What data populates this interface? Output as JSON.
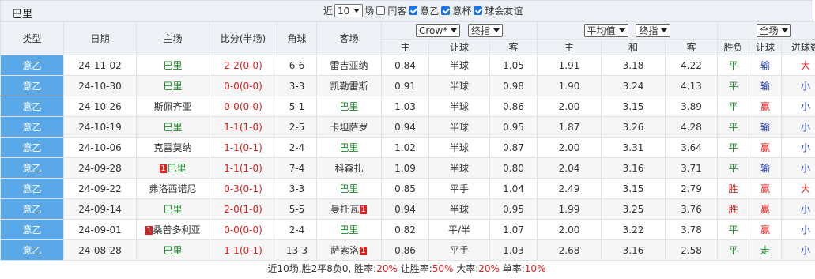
{
  "header": {
    "team_title": "巴里",
    "near_label": "近",
    "count_select": "10",
    "games_label": "场",
    "same_host_label": "同客",
    "filter_league1": "意乙",
    "filter_league2": "意杯",
    "filter_friendly": "球会友谊",
    "same_host_checked": false,
    "league1_checked": true,
    "league2_checked": true,
    "friendly_checked": true
  },
  "columns": {
    "type": "类型",
    "date": "日期",
    "home": "主场",
    "score": "比分(半场)",
    "corner": "角球",
    "away": "客场",
    "company_select": "Crow*",
    "odds_type_select": "终指",
    "avg_select": "平均值",
    "avg_type_select": "终指",
    "scope_select": "全场",
    "h_home": "主",
    "h_handicap": "让球",
    "h_away": "客",
    "h2_home": "主",
    "h2_draw": "和",
    "h2_away": "客",
    "h_result": "胜负",
    "h_handicap_result": "让球",
    "h_goals": "进球数"
  },
  "rows": [
    {
      "league": "意乙",
      "date": "24-11-02",
      "home": "巴里",
      "home_red": "",
      "home_is_team": true,
      "score": "2-2",
      "half": "(0-0)",
      "score_color": "red",
      "corner": "6-6",
      "away": "雷吉亚纳",
      "away_red": "",
      "away_is_team": false,
      "o_home": "0.84",
      "handicap": "半球",
      "o_away": "1.05",
      "a_home": "1.91",
      "a_draw": "3.18",
      "a_away": "4.22",
      "result": "平",
      "res_color": "green",
      "hres": "输",
      "hres_color": "blue",
      "goals": "大",
      "goals_color": "red"
    },
    {
      "league": "意乙",
      "date": "24-10-30",
      "home": "巴里",
      "home_red": "",
      "home_is_team": true,
      "score": "0-0",
      "half": "(0-0)",
      "score_color": "red",
      "corner": "3-3",
      "away": "凯勒雷斯",
      "away_red": "",
      "away_is_team": false,
      "o_home": "0.91",
      "handicap": "半球",
      "o_away": "0.98",
      "a_home": "1.90",
      "a_draw": "3.24",
      "a_away": "4.13",
      "result": "平",
      "res_color": "green",
      "hres": "输",
      "hres_color": "blue",
      "goals": "小",
      "goals_color": "blue"
    },
    {
      "league": "意乙",
      "date": "24-10-26",
      "home": "斯佩齐亚",
      "home_red": "",
      "home_is_team": false,
      "score": "0-0",
      "half": "(0-0)",
      "score_color": "red",
      "corner": "5-1",
      "away": "巴里",
      "away_red": "",
      "away_is_team": true,
      "o_home": "1.03",
      "handicap": "半球",
      "o_away": "0.86",
      "a_home": "2.00",
      "a_draw": "3.15",
      "a_away": "3.89",
      "result": "平",
      "res_color": "green",
      "hres": "赢",
      "hres_color": "red",
      "goals": "小",
      "goals_color": "blue"
    },
    {
      "league": "意乙",
      "date": "24-10-19",
      "home": "巴里",
      "home_red": "",
      "home_is_team": true,
      "score": "1-1",
      "half": "(1-0)",
      "score_color": "red",
      "corner": "2-5",
      "away": "卡坦萨罗",
      "away_red": "",
      "away_is_team": false,
      "o_home": "0.94",
      "handicap": "半球",
      "o_away": "0.95",
      "a_home": "1.87",
      "a_draw": "3.26",
      "a_away": "4.28",
      "result": "平",
      "res_color": "green",
      "hres": "输",
      "hres_color": "blue",
      "goals": "小",
      "goals_color": "blue"
    },
    {
      "league": "意乙",
      "date": "24-10-06",
      "home": "克雷莫纳",
      "home_red": "",
      "home_is_team": false,
      "score": "1-1",
      "half": "(0-1)",
      "score_color": "red",
      "corner": "2-4",
      "away": "巴里",
      "away_red": "",
      "away_is_team": true,
      "o_home": "1.02",
      "handicap": "半球",
      "o_away": "0.87",
      "a_home": "2.00",
      "a_draw": "3.31",
      "a_away": "3.64",
      "result": "平",
      "res_color": "green",
      "hres": "赢",
      "hres_color": "red",
      "goals": "小",
      "goals_color": "blue"
    },
    {
      "league": "意乙",
      "date": "24-09-28",
      "home": "巴里",
      "home_red": "1",
      "home_is_team": true,
      "score": "1-1",
      "half": "(1-0)",
      "score_color": "red",
      "corner": "7-4",
      "away": "科森扎",
      "away_red": "",
      "away_is_team": false,
      "o_home": "1.09",
      "handicap": "半球",
      "o_away": "0.80",
      "a_home": "2.04",
      "a_draw": "3.16",
      "a_away": "3.71",
      "result": "平",
      "res_color": "green",
      "hres": "输",
      "hres_color": "blue",
      "goals": "小",
      "goals_color": "blue"
    },
    {
      "league": "意乙",
      "date": "24-09-22",
      "home": "弗洛西诺尼",
      "home_red": "",
      "home_is_team": false,
      "score": "0-3",
      "half": "(0-1)",
      "score_color": "red",
      "corner": "3-3",
      "away": "巴里",
      "away_red": "",
      "away_is_team": true,
      "o_home": "0.85",
      "handicap": "平手",
      "o_away": "1.04",
      "a_home": "2.49",
      "a_draw": "3.15",
      "a_away": "2.79",
      "result": "胜",
      "res_color": "red",
      "hres": "赢",
      "hres_color": "red",
      "goals": "大",
      "goals_color": "red"
    },
    {
      "league": "意乙",
      "date": "24-09-14",
      "home": "巴里",
      "home_red": "",
      "home_is_team": true,
      "score": "2-0",
      "half": "(1-0)",
      "score_color": "red",
      "corner": "5-5",
      "away": "曼托瓦",
      "away_red": "1",
      "away_is_team": false,
      "o_home": "0.94",
      "handicap": "半球",
      "o_away": "0.95",
      "a_home": "1.99",
      "a_draw": "3.25",
      "a_away": "3.76",
      "result": "胜",
      "res_color": "red",
      "hres": "赢",
      "hres_color": "red",
      "goals": "小",
      "goals_color": "blue"
    },
    {
      "league": "意乙",
      "date": "24-09-01",
      "home": "桑普多利亚",
      "home_red": "1",
      "home_is_team": false,
      "score": "0-0",
      "half": "(0-0)",
      "score_color": "red",
      "corner": "2-4",
      "away": "巴里",
      "away_red": "",
      "away_is_team": true,
      "o_home": "0.82",
      "handicap": "平/半",
      "o_away": "1.07",
      "a_home": "2.00",
      "a_draw": "3.22",
      "a_away": "3.78",
      "result": "平",
      "res_color": "green",
      "hres": "赢",
      "hres_color": "red",
      "goals": "小",
      "goals_color": "blue"
    },
    {
      "league": "意乙",
      "date": "24-08-28",
      "home": "巴里",
      "home_red": "",
      "home_is_team": true,
      "score": "1-1",
      "half": "(0-1)",
      "score_color": "red",
      "corner": "13-3",
      "away": "萨索洛",
      "away_red": "1",
      "away_is_team": false,
      "o_home": "0.86",
      "handicap": "平手",
      "o_away": "1.03",
      "a_home": "2.68",
      "a_draw": "3.16",
      "a_away": "2.58",
      "result": "平",
      "res_color": "green",
      "hres": "走",
      "hres_color": "green",
      "goals": "小",
      "goals_color": "blue"
    }
  ],
  "footer": {
    "prefix": "近10场,胜2平8负0, 胜率:",
    "win_rate": "20%",
    "hc_label": " 让胜率:",
    "hc_rate": "50%",
    "big_label": " 大率:",
    "big_rate": "20%",
    "odd_label": " 单率:",
    "odd_rate": "10%"
  }
}
